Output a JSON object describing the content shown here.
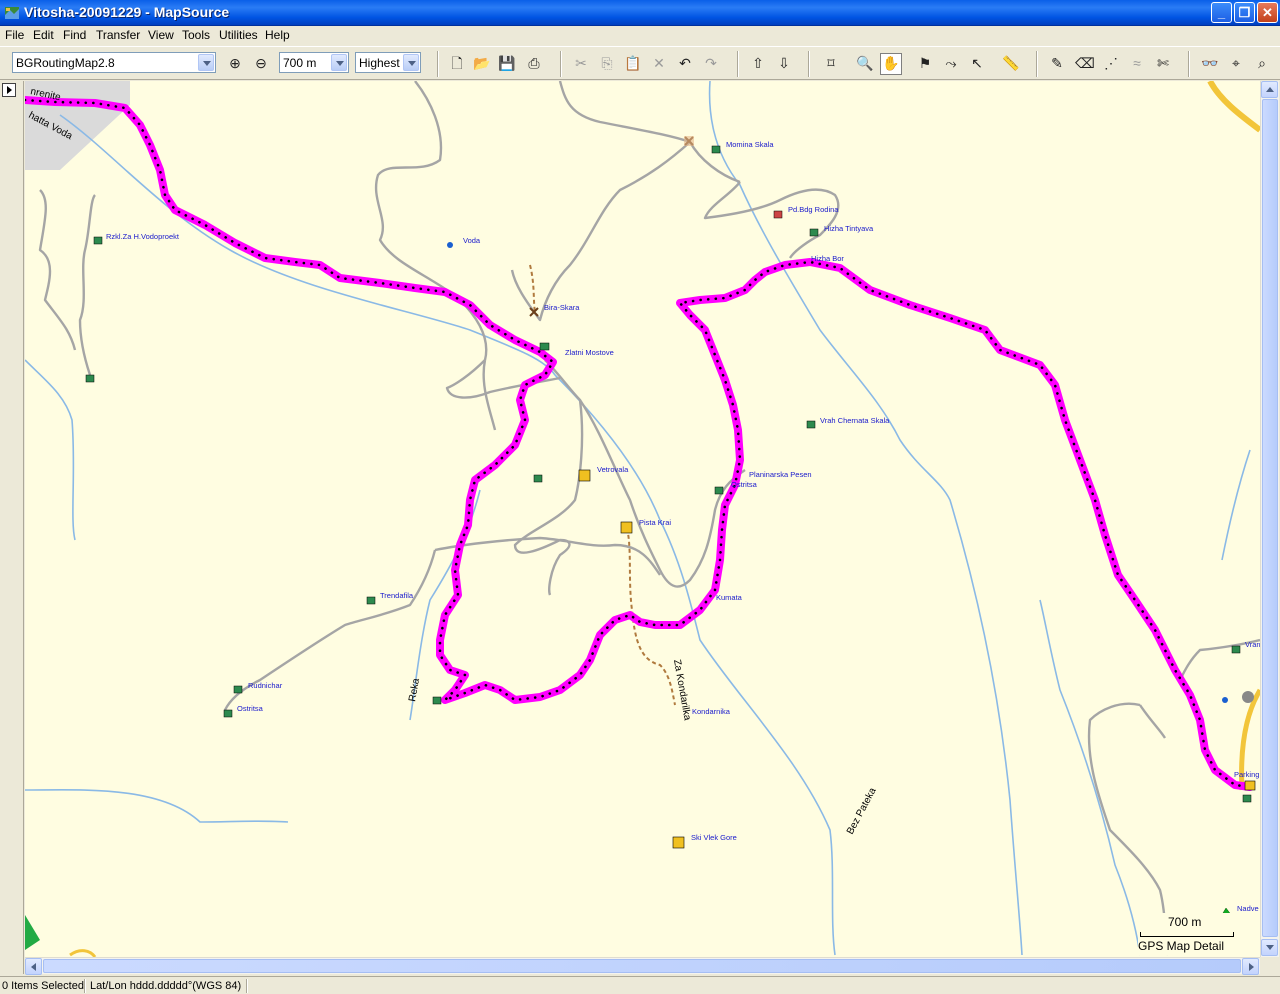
{
  "window": {
    "title": "Vitosha-20091229 - MapSource",
    "minimize": "_",
    "maximize": "❐",
    "close": "✕"
  },
  "menu": [
    "File",
    "Edit",
    "Find",
    "Transfer",
    "View",
    "Tools",
    "Utilities",
    "Help"
  ],
  "toolbar": {
    "map_product": "BGRoutingMap2.8",
    "zoom_scale": "700 m",
    "detail_level": "Highest"
  },
  "map": {
    "roads": [
      "Reka",
      "Za Kondarilka",
      "Bez Pateka",
      "hatta Voda",
      "nrenite"
    ],
    "pois": [
      {
        "name": "Momina Skala",
        "kind": "hut"
      },
      {
        "name": "Pd.Bdg Rodina",
        "kind": "lodge"
      },
      {
        "name": "Hizha Tintyava",
        "kind": "hut"
      },
      {
        "name": "Hizha Bor",
        "kind": "hut"
      },
      {
        "name": "Voda",
        "kind": "water"
      },
      {
        "name": "Rzkl.Za H.Vodoproekt",
        "kind": "hut"
      },
      {
        "name": "Bira-Skara",
        "kind": "ruin"
      },
      {
        "name": "Zlatni Mostove",
        "kind": "hut"
      },
      {
        "name": "Vrah Chernata Skala",
        "kind": "hut"
      },
      {
        "name": "Vetrovala",
        "kind": "ski-lift"
      },
      {
        "name": "Planinarska Pesen",
        "kind": "hut"
      },
      {
        "name": "Ostritsa",
        "kind": "hut"
      },
      {
        "name": "Pista Krai",
        "kind": "ski-lift"
      },
      {
        "name": "Trendafila",
        "kind": "hut"
      },
      {
        "name": "Kumata",
        "kind": "hut"
      },
      {
        "name": "Rudnichar",
        "kind": "hut"
      },
      {
        "name": "Ostritsa",
        "kind": "hut"
      },
      {
        "name": "Kondarnika",
        "kind": "label"
      },
      {
        "name": "Ski Vlek Gore",
        "kind": "ski-lift"
      },
      {
        "name": "Vran",
        "kind": "hut"
      },
      {
        "name": "Parking",
        "kind": "parking"
      },
      {
        "name": "Nadve",
        "kind": "peak"
      }
    ],
    "scale_distance": "700 m",
    "scale_caption": "GPS Map Detail",
    "track_color": "#ff00ff",
    "road_color": "#a0a0a0",
    "stream_color": "#7fb3e0"
  },
  "status": {
    "selection": "0 Items Selected",
    "position_format": "Lat/Lon hddd.ddddd°(WGS 84)"
  }
}
